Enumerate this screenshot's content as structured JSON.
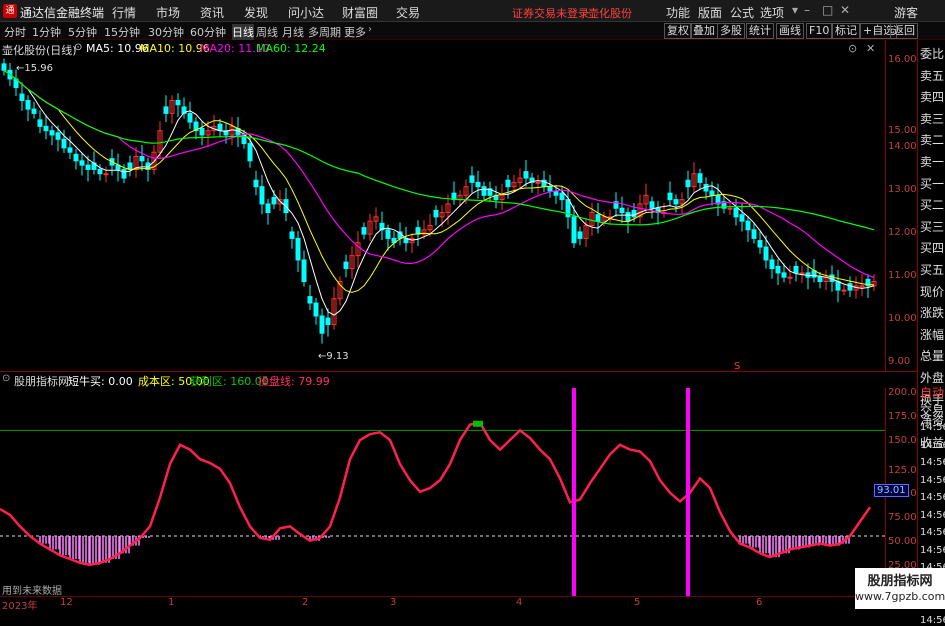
{
  "titlebar": {
    "app_name": "通达信金融终端",
    "menus": [
      "行情",
      "市场",
      "资讯",
      "发现",
      "问小达",
      "财富圈",
      "交易"
    ],
    "notice": "证券交易未登录",
    "stock_name": "壶化股份",
    "right_menus": [
      "功能",
      "版面",
      "公式",
      "选项"
    ],
    "guest": "游客"
  },
  "toolbar": {
    "timeframes": [
      "分时",
      "1分钟",
      "5分钟",
      "15分钟",
      "30分钟",
      "60分钟",
      "日线",
      "周线",
      "月线",
      "多周期",
      "更多"
    ],
    "active_timeframe": "日线",
    "right_buttons": [
      "复权",
      "叠加",
      "多股",
      "统计",
      "画线",
      "F10",
      "标记",
      "+自选",
      "返回"
    ]
  },
  "main": {
    "title": "壶化股份(日线)",
    "ma_labels": [
      {
        "text": "MA5: 10.96",
        "color": "#ffffff"
      },
      {
        "text": "MA10: 10.96",
        "color": "#ffff00"
      },
      {
        "text": "MA20: 11.10",
        "color": "#ff00ff"
      },
      {
        "text": "MA60: 12.24",
        "color": "#00ff00"
      }
    ],
    "high_label": "15.96",
    "low_label": "9.13",
    "y_ticks": [
      "16.00",
      "15.00",
      "14.00",
      "13.00",
      "12.00",
      "11.00",
      "10.00",
      "9.00"
    ],
    "marker": "S"
  },
  "side_panel": {
    "items": [
      "委比",
      "卖五",
      "卖四",
      "卖三",
      "卖二",
      "卖一",
      "买一",
      "买二",
      "买三",
      "买四",
      "买五",
      "现价",
      "涨跌",
      "涨幅",
      "总量",
      "外盘",
      "换手",
      "净资",
      "收益",
      "自动",
      "交易"
    ]
  },
  "indicator": {
    "name": "股朋指标网",
    "items": [
      {
        "text": "短牛买: 0.00",
        "color": "#ffffff"
      },
      {
        "text": "成本区: 50.00",
        "color": "#ffff00"
      },
      {
        "text": "获利区: 160.00",
        "color": "#00c000"
      },
      {
        "text": "操盘线: 79.99",
        "color": "#ff3060"
      }
    ],
    "y_ticks": [
      "200.0",
      "175.0",
      "150.0",
      "125.0",
      "100.0",
      "75.00",
      "50.00",
      "25.00"
    ],
    "current_value": "93.01",
    "time_labels": [
      "14:56",
      "14:56",
      "14:56",
      "14:56",
      "14:56",
      "14:56",
      "14:56",
      "14:56",
      "14:56",
      "14:56",
      "14:56",
      "14:56"
    ],
    "footer_hint": "用到未来数据"
  },
  "bottom_axis": {
    "labels": [
      "2023年",
      "12",
      "1",
      "2",
      "3",
      "4",
      "5",
      "6"
    ]
  },
  "watermark": {
    "line1": "股朋指标网",
    "line2": "www.7gpzb.com"
  },
  "colors": {
    "up": "#ff3030",
    "down": "#00ffff",
    "ma5": "#ffffff",
    "ma10": "#ffff00",
    "ma20": "#ff00ff",
    "ma60": "#00ff00",
    "line": "#ff2050",
    "bars": "#ff80ff"
  }
}
